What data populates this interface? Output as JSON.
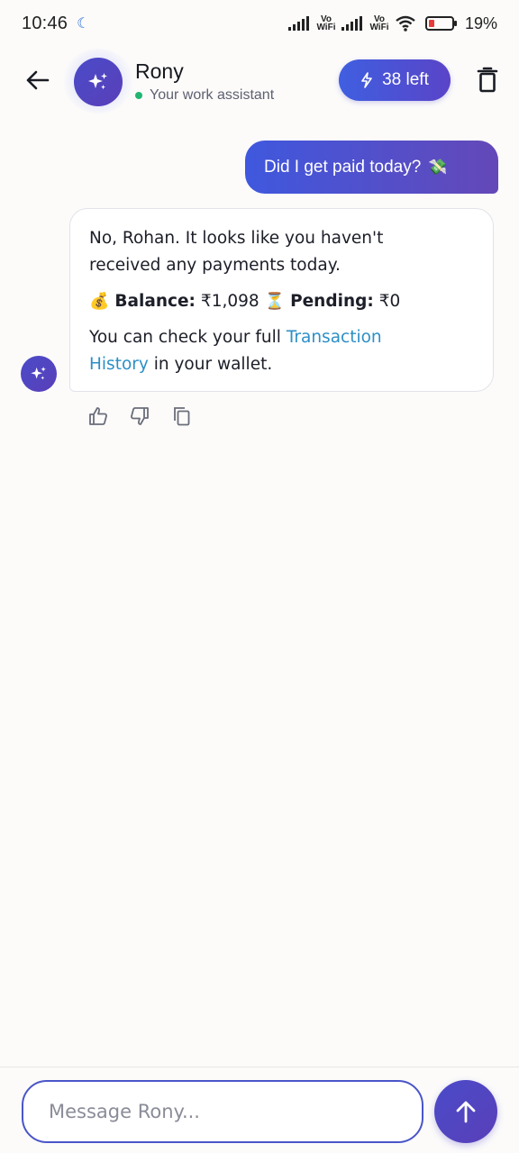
{
  "status_bar": {
    "time": "10:46",
    "network_label_1": "Vo WiFi",
    "network_label_2": "Vo WiFi",
    "battery": "19%"
  },
  "header": {
    "name": "Rony",
    "subtitle": "Your work assistant",
    "credits_label": "38 left",
    "icons": {
      "back": "arrow-left-icon",
      "avatar": "sparkles-icon",
      "credits": "lightning-icon",
      "delete": "trash-icon"
    }
  },
  "messages": {
    "user": {
      "text": "Did I get paid today?",
      "emoji": "💸"
    },
    "bot": {
      "line1": "No, Rohan. It looks like you haven't",
      "line2": "received any payments today.",
      "balance_emoji": "💰",
      "balance_label": "Balance:",
      "balance_value": "₹1,098",
      "pending_emoji": "⏳",
      "pending_label": "Pending:",
      "pending_value": "₹0",
      "footer_pre": "You can check your full",
      "footer_link_1": "Transaction",
      "footer_link_2": "History",
      "footer_post": "in your wallet."
    },
    "actions": [
      "thumbs-up-icon",
      "thumbs-down-icon",
      "copy-icon"
    ]
  },
  "composer": {
    "placeholder": "Message Rony...",
    "value": ""
  },
  "colors": {
    "accent": "#4a4bc9",
    "accent_2": "#5a3fb8",
    "link": "#2c8fc7",
    "online": "#22b573",
    "background": "#fcfbfa"
  }
}
